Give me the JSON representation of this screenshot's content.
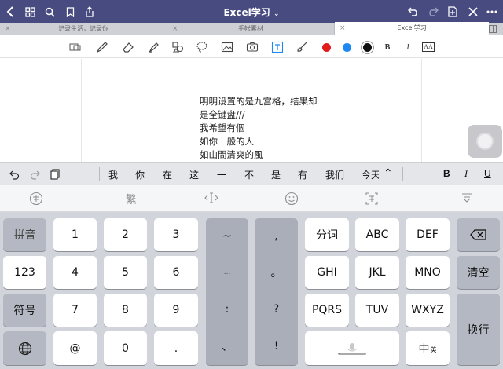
{
  "window": {
    "title": "Excel学习",
    "title_chevron": "⌄"
  },
  "tabs": [
    {
      "label": "记录生活，记录你",
      "close": "×",
      "active": false
    },
    {
      "label": "手帐素材",
      "close": "×",
      "active": false
    },
    {
      "label": "Excel学习",
      "close": "×",
      "active": true
    }
  ],
  "toolbar": {
    "bold_label": "B",
    "italic_label": "I",
    "ocr_label": "AA",
    "colors": {
      "red": "#e31b1b",
      "blue": "#1d87f2",
      "black": "#111111"
    }
  },
  "note": {
    "lines": [
      "明明设置的是九宫格，结果却",
      "是全键盘///",
      "我希望有個",
      "如你一般的人",
      "如山間清爽的風"
    ]
  },
  "suggestions": {
    "items": [
      "我",
      "你",
      "在",
      "这",
      "一",
      "不",
      "是",
      "有",
      "我们",
      "今天"
    ],
    "collapse": "⌃",
    "bold": "B",
    "italic": "I",
    "underline": "U"
  },
  "function_row": {
    "labels": [
      "繁"
    ]
  },
  "keyboard": {
    "left_col": [
      "拼音",
      "123",
      "符号"
    ],
    "digits": [
      "1",
      "2",
      "3",
      "4",
      "5",
      "6",
      "7",
      "8",
      "9"
    ],
    "bottom_row": {
      "at": "@",
      "zero": "0",
      "dot": "."
    },
    "punct_left": [
      "~",
      "...",
      ":",
      "、"
    ],
    "punct_right": [
      ",",
      "。",
      "?",
      "!"
    ],
    "letters": [
      "分词",
      "ABC",
      "DEF",
      "GHI",
      "JKL",
      "MNO",
      "PQRS",
      "TUV",
      "WXYZ"
    ],
    "delete_icon": "⌫",
    "clear": "清空",
    "enter": "换行",
    "lang_main": "中",
    "lang_sub": "英"
  }
}
